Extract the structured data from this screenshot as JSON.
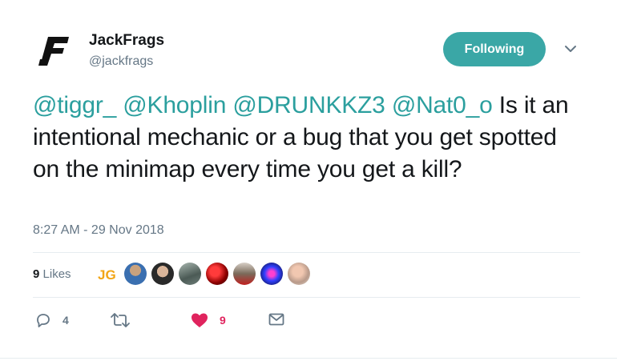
{
  "author": {
    "name": "JackFrags",
    "handle": "@jackfrags",
    "logo_icon": "jackfrags-logo-icon"
  },
  "follow_button": {
    "label": "Following",
    "color": "#3aa7a6"
  },
  "tweet": {
    "mentions": [
      "@tiggr_",
      "@Khoplin",
      "@DRUNKKZ3",
      "@Nat0_o"
    ],
    "text": "Is it an intentional mechanic or a bug that you get spotted on the minimap every time you get a kill?",
    "timestamp": "8:27 AM - 29 Nov 2018"
  },
  "likes": {
    "count": "9",
    "label": "Likes"
  },
  "liker_avatars": [
    {
      "name": "avatar-jg-logo"
    },
    {
      "name": "avatar-2"
    },
    {
      "name": "avatar-3"
    },
    {
      "name": "avatar-4"
    },
    {
      "name": "avatar-5"
    },
    {
      "name": "avatar-6"
    },
    {
      "name": "avatar-7"
    },
    {
      "name": "avatar-8"
    }
  ],
  "actions": {
    "reply": {
      "icon": "reply-icon",
      "count": "4"
    },
    "retweet": {
      "icon": "retweet-icon",
      "count": ""
    },
    "like": {
      "icon": "heart-icon",
      "count": "9",
      "color": "#e0245e"
    },
    "dm": {
      "icon": "envelope-icon"
    }
  },
  "colors": {
    "mention": "#2b9f9e",
    "secondary_text": "#657786",
    "divider": "#e6ecf0"
  }
}
